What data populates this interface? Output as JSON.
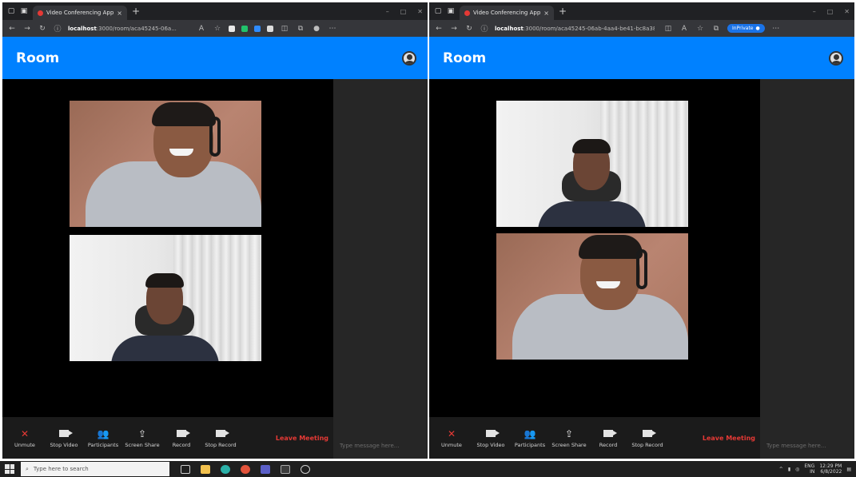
{
  "browser": {
    "tab_title": "Video Conferencing App",
    "tab_close": "×",
    "new_tab": "+",
    "window_controls": [
      "–",
      "□",
      "✕"
    ],
    "url_left_host": "localhost",
    "url_left_rest": ":3000/room/aca45245-06a...",
    "url_right_host": "localhost",
    "url_right_rest": ":3000/room/aca45245-06ab-4aa4-be41-bc8a383...",
    "inprivate_label": "InPrivate"
  },
  "app": {
    "title": "Room",
    "header_color": "#0081ff"
  },
  "controls": {
    "unmute": "Unmute",
    "stop_video": "Stop Video",
    "participants": "Participants",
    "screen_share": "Screen Share",
    "record": "Record",
    "stop_record": "Stop Record",
    "leave": "Leave Meeting"
  },
  "chat": {
    "placeholder": "Type message here..."
  },
  "taskbar": {
    "search_placeholder": "Type here to search",
    "lang": "ENG",
    "region": "IN",
    "time": "12:29 PM",
    "date": "6/8/2022"
  },
  "colors": {
    "leave": "#e53935",
    "video_bg": "#000000",
    "control_bar": "#1b1b1b",
    "chat_bg": "#262626"
  }
}
